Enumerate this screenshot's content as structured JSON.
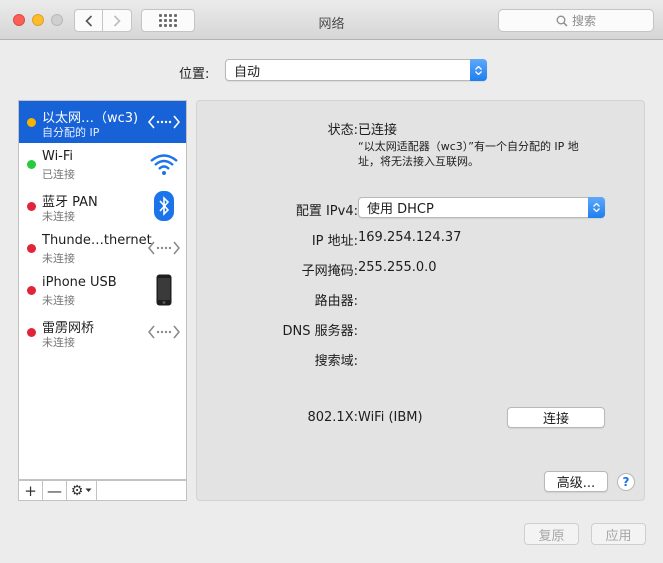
{
  "window": {
    "title": "网络"
  },
  "toolbar": {
    "search_placeholder": "搜索"
  },
  "location": {
    "label": "位置:",
    "value": "自动"
  },
  "services": [
    {
      "name": "以太网…（wc3)",
      "status": "自分配的 IP",
      "dot_color": "#f5b400",
      "icon": "ethernet-arrows-icon",
      "selected": true
    },
    {
      "name": "Wi-Fi",
      "status": "已连接",
      "dot_color": "#27c93f",
      "icon": "wifi-icon",
      "selected": false
    },
    {
      "name": "蓝牙 PAN",
      "status": "未连接",
      "dot_color": "#e0243a",
      "icon": "bluetooth-icon",
      "selected": false
    },
    {
      "name": "Thunde…thernet",
      "status": "未连接",
      "dot_color": "#e0243a",
      "icon": "ethernet-arrows-icon",
      "selected": false
    },
    {
      "name": "iPhone USB",
      "status": "未连接",
      "dot_color": "#e0243a",
      "icon": "iphone-icon",
      "selected": false
    },
    {
      "name": "雷雳网桥",
      "status": "未连接",
      "dot_color": "#e0243a",
      "icon": "ethernet-arrows-icon",
      "selected": false
    }
  ],
  "sidebar_toolbar": {
    "add": "+",
    "remove": "—",
    "gear": "⚙"
  },
  "detail": {
    "status_label": "状态:",
    "status_value": "已连接",
    "status_desc_line1": "“以太网适配器（wc3）”有一个自分配的 IP 地",
    "status_desc_line2": "址，将无法接入互联网。",
    "ipv4_label": "配置 IPv4:",
    "ipv4_value": "使用 DHCP",
    "ip_label": "IP 地址:",
    "ip_value": "169.254.124.37",
    "mask_label": "子网掩码:",
    "mask_value": "255.255.0.0",
    "router_label": "路由器:",
    "dns_label": "DNS 服务器:",
    "search_domain_label": "搜索域:",
    "dot1x_label": "802.1X:",
    "dot1x_value": "WiFi (IBM)",
    "connect_button": "连接",
    "advanced_button": "高级...",
    "help_button": "?"
  },
  "footer": {
    "revert_button": "复原",
    "apply_button": "应用"
  },
  "colors": {
    "accent": "#1862d8",
    "popup_blue": "#1e7ef0"
  }
}
